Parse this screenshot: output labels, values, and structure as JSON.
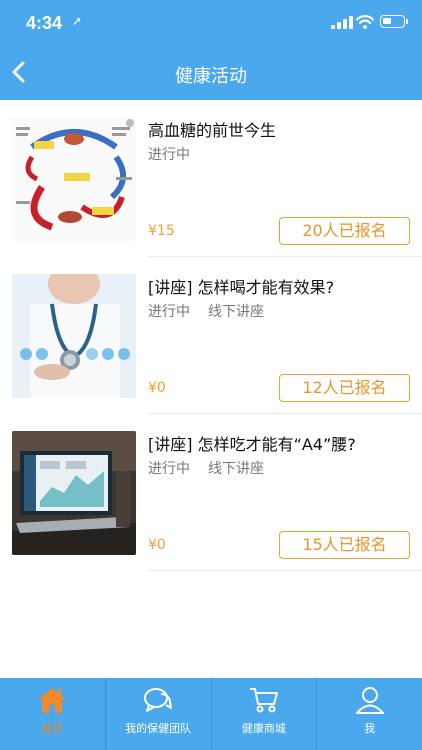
{
  "status_bar": {
    "time": "4:34"
  },
  "nav": {
    "title": "健康活动"
  },
  "activities": [
    {
      "title": "高血糖的前世今生",
      "status": "进行中",
      "mode": "",
      "price": "¥15",
      "signup": "20人已报名"
    },
    {
      "title": "[讲座] 怎样喝才能有效果?",
      "status": "进行中",
      "mode": "线下讲座",
      "price": "¥0",
      "signup": "12人已报名"
    },
    {
      "title": "[讲座] 怎样吃才能有“A4”腰?",
      "status": "进行中",
      "mode": "线下讲座",
      "price": "¥0",
      "signup": "15人已报名"
    }
  ],
  "tabs": [
    {
      "label": "首页",
      "icon": "home-icon",
      "active": true
    },
    {
      "label": "我的保健团队",
      "icon": "chat-icon",
      "active": false
    },
    {
      "label": "健康商城",
      "icon": "cart-icon",
      "active": false
    },
    {
      "label": "我",
      "icon": "user-icon",
      "active": false
    }
  ],
  "colors": {
    "primary": "#4aa8ec",
    "accent": "#f0a030",
    "active_tab": "#f08a2a"
  }
}
